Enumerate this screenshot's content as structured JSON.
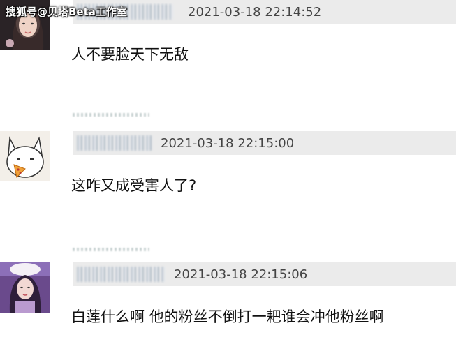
{
  "watermark": {
    "text": "搜狐号@贝塔Beta工作室"
  },
  "comments": [
    {
      "timestamp": "2021-03-18 22:14:52",
      "text": "人不要脸天下无敌"
    },
    {
      "timestamp": "2021-03-18 22:15:00",
      "text": "这咋又成受害人了?"
    },
    {
      "timestamp": "2021-03-18 22:15:06",
      "text": "白莲什么啊 他的粉丝不倒打一耙谁会冲他粉丝啊"
    }
  ]
}
